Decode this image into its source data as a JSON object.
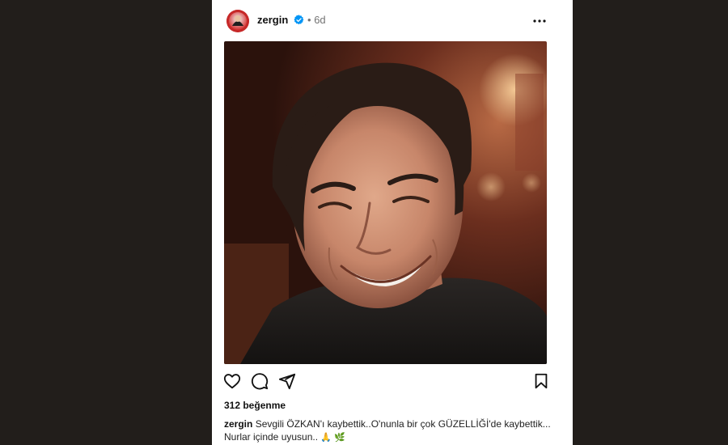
{
  "post": {
    "username": "zergin",
    "time_separator": "•",
    "timestamp": "6d",
    "likes": "312 beğenme",
    "caption_user": "zergin",
    "caption_line1": "Sevgili ÖZKAN'ı kaybettik..O'nunla bir çok GÜZELLİĞİ'de kaybettik...",
    "caption_line2": "Nurlar içinde uyusun..",
    "caption_emojis": "🙏 🌿"
  },
  "icons": {
    "avatar": "profile-avatar",
    "verified": "verified-badge-icon",
    "more": "more-options-icon",
    "like": "heart-icon",
    "comment": "comment-icon",
    "share": "send-icon",
    "save": "bookmark-icon"
  },
  "colors": {
    "background": "#221e1b",
    "card": "#ffffff",
    "verified": "#0095f6",
    "muted_text": "#737373"
  }
}
